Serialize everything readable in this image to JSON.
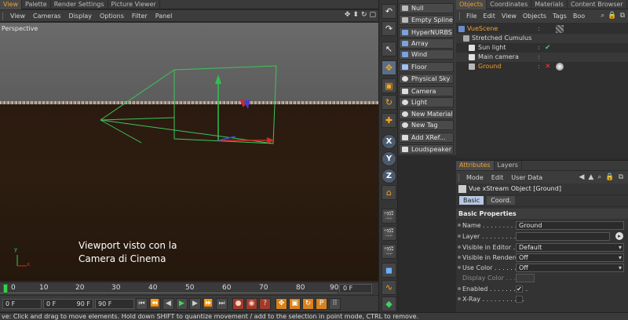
{
  "left_tabs": [
    "View",
    "Palette",
    "Render Settings",
    "Picture Viewer"
  ],
  "viewport_menu": [
    "View",
    "Cameras",
    "Display",
    "Options",
    "Filter",
    "Panel"
  ],
  "viewport": {
    "label": "Perspective",
    "caption_line1": "Viewport visto con la",
    "caption_line2": "Camera di Cinema",
    "axis_y": "y",
    "axis_x": "x"
  },
  "timeline": {
    "ticks": [
      "0",
      "10",
      "20",
      "30",
      "40",
      "50",
      "60",
      "70",
      "80",
      "90"
    ],
    "end_field": "0 F"
  },
  "playbar": {
    "start": "0 F",
    "min": "0 F",
    "max": "90 F",
    "end": "90 F"
  },
  "palette": [
    {
      "label": "Null",
      "color": "#bbbbbb"
    },
    {
      "label": "Empty Spline",
      "color": "#bbbbbb"
    },
    {
      "label": "HyperNURBS",
      "color": "#7aa2e0"
    },
    {
      "label": "Array",
      "color": "#7aa2e0"
    },
    {
      "label": "Wind",
      "color": "#7aa2e0"
    },
    {
      "label": "Floor",
      "color": "#9fc3ff"
    },
    {
      "label": "Physical Sky",
      "color": "#dddddd"
    },
    {
      "label": "Camera",
      "color": "#dddddd"
    },
    {
      "label": "Light",
      "color": "#dddddd"
    },
    {
      "label": "New Material",
      "color": "#dddddd"
    },
    {
      "label": "New Tag",
      "color": "#dddddd"
    },
    {
      "label": "Add XRef...",
      "color": "#dddddd"
    },
    {
      "label": "Loudspeaker",
      "color": "#dddddd"
    }
  ],
  "object_manager": {
    "tabs": [
      "Objects",
      "Coordinates",
      "Materials",
      "Content Browser"
    ],
    "menu": [
      "File",
      "Edit",
      "View",
      "Objects",
      "Tags",
      "Boo"
    ],
    "rows": [
      {
        "name": "VueScene",
        "color": "#f0a030"
      },
      {
        "name": "Stretched Cumulus",
        "color": "#d0d0d0"
      },
      {
        "name": "Sun light",
        "color": "#d0d0d0"
      },
      {
        "name": "Main camera",
        "color": "#d0d0d0"
      },
      {
        "name": "Ground",
        "color": "#f0a030"
      }
    ]
  },
  "attributes": {
    "tabs": [
      "Attributes",
      "Layers"
    ],
    "menu": [
      "Mode",
      "Edit",
      "User Data"
    ],
    "object_title": "Vue xStream Object [Ground]",
    "subtabs": [
      "Basic",
      "Coord."
    ],
    "section": "Basic Properties",
    "props": [
      {
        "label": "Name . . . . . . . . . . . . . .",
        "value": "Ground"
      },
      {
        "label": "Layer . . . . . . . . . . . . .",
        "value": ""
      },
      {
        "label": "Visible in Editor . . .",
        "value": "Default"
      },
      {
        "label": "Visible in Renderer",
        "value": "Off"
      },
      {
        "label": "Use Color . . . . . . . .",
        "value": "Off"
      },
      {
        "label": "Display Color . . .",
        "value": ""
      },
      {
        "label": "Enabled . . . . . . . . . .",
        "value": "✔"
      },
      {
        "label": "X-Ray . . . . . . . . . . .",
        "value": ""
      }
    ]
  },
  "status_text": "ve: Click and drag to move elements. Hold down SHIFT to quantize movement / add to the selection in point mode, CTRL to remove."
}
